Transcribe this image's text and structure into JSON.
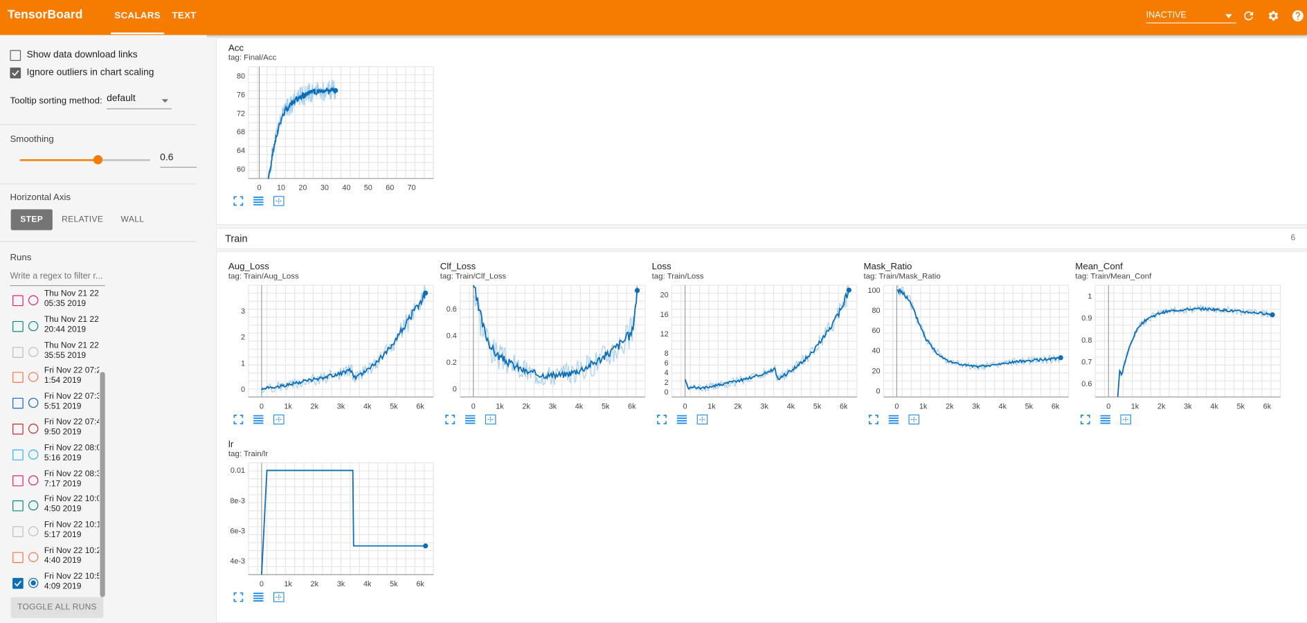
{
  "colors": {
    "accent": "#f57c00",
    "series": "#0d6eb5",
    "series_light": "#a7cff0"
  },
  "header": {
    "brand": "TensorBoard",
    "tabs": [
      "SCALARS",
      "TEXT"
    ],
    "status": "INACTIVE",
    "icons": [
      "refresh-icon",
      "settings-icon",
      "help-icon"
    ]
  },
  "sidebar": {
    "show_download": "Show data download links",
    "ignore_outliers": "Ignore outliers in chart scaling",
    "show_download_checked": false,
    "ignore_outliers_checked": true,
    "tooltip_label": "Tooltip sorting method:",
    "tooltip_value": "default",
    "smoothing_label": "Smoothing",
    "smoothing_value": "0.6",
    "smoothing_fraction": 0.6,
    "haxis_label": "Horizontal Axis",
    "haxis_options": [
      "STEP",
      "RELATIVE",
      "WALL"
    ],
    "haxis_selected": "STEP",
    "runs_label": "Runs",
    "filter_placeholder": "Write a regex to filter r...",
    "toggle_label": "TOGGLE ALL RUNS",
    "runs": [
      {
        "line1": "Thu Nov 21 22:",
        "line2": "05:35 2019",
        "color": "#e91e63",
        "checked": false
      },
      {
        "line1": "Thu Nov 21 22:",
        "line2": "20:44 2019",
        "color": "#00897b",
        "checked": false
      },
      {
        "line1": "Thu Nov 21 22:",
        "line2": "35:55 2019",
        "color": "#bdbdbd",
        "checked": false
      },
      {
        "line1": "Fri Nov 22 07:2",
        "line2": "1:54 2019",
        "color": "#ff7043",
        "checked": false
      },
      {
        "line1": "Fri Nov 22 07:3",
        "line2": "5:51 2019",
        "color": "#1565c0",
        "checked": false
      },
      {
        "line1": "Fri Nov 22 07:4",
        "line2": "9:50 2019",
        "color": "#c62828",
        "checked": false
      },
      {
        "line1": "Fri Nov 22 08:0",
        "line2": "5:16 2019",
        "color": "#29b6f6",
        "checked": false
      },
      {
        "line1": "Fri Nov 22 08:3",
        "line2": "7:17 2019",
        "color": "#e91e63",
        "checked": false
      },
      {
        "line1": "Fri Nov 22 10:0",
        "line2": "4:50 2019",
        "color": "#00897b",
        "checked": false
      },
      {
        "line1": "Fri Nov 22 10:1",
        "line2": "5:17 2019",
        "color": "#bdbdbd",
        "checked": false
      },
      {
        "line1": "Fri Nov 22 10:2",
        "line2": "4:40 2019",
        "color": "#ff7043",
        "checked": false
      },
      {
        "line1": "Fri Nov 22 10:5",
        "line2": "4:09 2019",
        "color": "#0d6eb5",
        "checked": true
      }
    ]
  },
  "main": {
    "train_section": {
      "name": "Train",
      "count": "6"
    },
    "chart_icons": [
      "expand-icon",
      "data-table-icon",
      "fit-domain-icon"
    ]
  },
  "chart_data": [
    {
      "id": "acc",
      "type": "line",
      "title": "Acc",
      "tag": "tag: Final/Acc",
      "xlim": [
        -5,
        80
      ],
      "ylim": [
        58,
        82
      ],
      "xticks": [
        "0",
        "10",
        "20",
        "30",
        "40",
        "50",
        "60",
        "70"
      ],
      "xtick_vals": [
        0,
        10,
        20,
        30,
        40,
        50,
        60,
        70
      ],
      "yticks": [
        "60",
        "64",
        "68",
        "72",
        "76",
        "80"
      ],
      "ytick_vals": [
        60,
        64,
        68,
        72,
        76,
        80
      ],
      "x": [
        4,
        6,
        8,
        10,
        12,
        14,
        16,
        18,
        20,
        23,
        26,
        30,
        35
      ],
      "y": [
        57,
        63,
        67.5,
        70.5,
        72.6,
        73.8,
        74.7,
        75.3,
        75.8,
        76.3,
        76.6,
        76.8,
        76.9
      ],
      "noise": 0.5,
      "seed": 1
    },
    {
      "id": "aug",
      "type": "line",
      "title": "Aug_Loss",
      "tag": "tag: Train/Aug_Loss",
      "xlim": [
        -500,
        6500
      ],
      "ylim": [
        -0.3,
        4
      ],
      "xticks": [
        "0",
        "1k",
        "2k",
        "3k",
        "4k",
        "5k",
        "6k"
      ],
      "xtick_vals": [
        0,
        1000,
        2000,
        3000,
        4000,
        5000,
        6000
      ],
      "yticks": [
        "0",
        "1",
        "2",
        "3"
      ],
      "ytick_vals": [
        0,
        1,
        2,
        3
      ],
      "x": [
        0,
        300,
        600,
        1000,
        1500,
        2000,
        2500,
        3000,
        3400,
        3500,
        3800,
        4200,
        4600,
        5000,
        5400,
        5700,
        6000,
        6200
      ],
      "y": [
        0,
        0.05,
        0.1,
        0.18,
        0.28,
        0.38,
        0.48,
        0.6,
        0.75,
        0.42,
        0.6,
        0.9,
        1.3,
        1.8,
        2.4,
        2.9,
        3.3,
        3.7
      ],
      "noise": 0.12,
      "seed": 2
    },
    {
      "id": "clf",
      "type": "line",
      "title": "Clf_Loss",
      "tag": "tag: Train/Clf_Loss",
      "xlim": [
        -500,
        6500
      ],
      "ylim": [
        -0.06,
        0.78
      ],
      "xticks": [
        "0",
        "1k",
        "2k",
        "3k",
        "4k",
        "5k",
        "6k"
      ],
      "xtick_vals": [
        0,
        1000,
        2000,
        3000,
        4000,
        5000,
        6000
      ],
      "yticks": [
        "0",
        "0.2",
        "0.4",
        "0.6"
      ],
      "ytick_vals": [
        0,
        0.2,
        0.4,
        0.6
      ],
      "x": [
        0,
        200,
        400,
        700,
        1000,
        1500,
        2000,
        2500,
        3000,
        3500,
        4000,
        4500,
        5000,
        5500,
        6000,
        6200
      ],
      "y": [
        0.78,
        0.6,
        0.45,
        0.3,
        0.24,
        0.18,
        0.13,
        0.11,
        0.1,
        0.11,
        0.14,
        0.19,
        0.25,
        0.33,
        0.42,
        0.74
      ],
      "noise": 0.04,
      "seed": 3
    },
    {
      "id": "loss",
      "type": "line",
      "title": "Loss",
      "tag": "tag: Train/Loss",
      "xlim": [
        -500,
        6500
      ],
      "ylim": [
        -1,
        22
      ],
      "xticks": [
        "0",
        "1k",
        "2k",
        "3k",
        "4k",
        "5k",
        "6k"
      ],
      "xtick_vals": [
        0,
        1000,
        2000,
        3000,
        4000,
        5000,
        6000
      ],
      "yticks": [
        "0",
        "2",
        "4",
        "6",
        "8",
        "12",
        "16",
        "20"
      ],
      "ytick_vals": [
        0,
        2,
        4,
        6,
        8,
        12,
        16,
        20
      ],
      "x": [
        0,
        150,
        300,
        500,
        1000,
        1500,
        2000,
        2500,
        3000,
        3400,
        3500,
        3800,
        4200,
        4600,
        5000,
        5400,
        5800,
        6200
      ],
      "y": [
        2.5,
        0.6,
        1.2,
        0.8,
        1.2,
        1.7,
        2.3,
        3,
        3.8,
        4.8,
        2.6,
        3.6,
        5.2,
        7,
        9.5,
        12.5,
        16,
        21
      ],
      "noise": 0.5,
      "seed": 4
    },
    {
      "id": "mask",
      "type": "line",
      "title": "Mask_Ratio",
      "tag": "tag: Train/Mask_Ratio",
      "xlim": [
        -500,
        6500
      ],
      "ylim": [
        -6,
        105
      ],
      "xticks": [
        "0",
        "1k",
        "2k",
        "3k",
        "4k",
        "5k",
        "6k"
      ],
      "xtick_vals": [
        0,
        1000,
        2000,
        3000,
        4000,
        5000,
        6000
      ],
      "yticks": [
        "0",
        "20",
        "40",
        "60",
        "80",
        "100"
      ],
      "ytick_vals": [
        0,
        20,
        40,
        60,
        80,
        100
      ],
      "x": [
        0,
        200,
        500,
        800,
        1100,
        1500,
        2000,
        2500,
        3000,
        3500,
        4000,
        4500,
        5000,
        5500,
        6000,
        6200
      ],
      "y": [
        100,
        99,
        88,
        70,
        52,
        38,
        29,
        26,
        24,
        25,
        27,
        29,
        30,
        31,
        32,
        33
      ],
      "noise": 1.6,
      "seed": 5
    },
    {
      "id": "conf",
      "type": "line",
      "title": "Mean_Conf",
      "tag": "tag: Train/Mean_Conf",
      "xlim": [
        -500,
        6500
      ],
      "ylim": [
        0.54,
        1.05
      ],
      "xticks": [
        "0",
        "1k",
        "2k",
        "3k",
        "4k",
        "5k",
        "6k"
      ],
      "xtick_vals": [
        0,
        1000,
        2000,
        3000,
        4000,
        5000,
        6000
      ],
      "yticks": [
        "0.6",
        "0.7",
        "0.8",
        "0.9",
        "1"
      ],
      "ytick_vals": [
        0.6,
        0.7,
        0.8,
        0.9,
        1
      ],
      "x": [
        350,
        420,
        500,
        600,
        800,
        1000,
        1200,
        1500,
        2000,
        2500,
        3000,
        3500,
        4000,
        5000,
        6000,
        6200
      ],
      "y": [
        0.54,
        0.66,
        0.64,
        0.69,
        0.77,
        0.83,
        0.87,
        0.9,
        0.925,
        0.935,
        0.94,
        0.942,
        0.94,
        0.93,
        0.92,
        0.915
      ],
      "noise": 0.004,
      "seed": 6
    },
    {
      "id": "lr",
      "type": "line",
      "title": "lr",
      "tag": "tag: Train/lr",
      "xlim": [
        -500,
        6500
      ],
      "ylim": [
        0.0031,
        0.0105
      ],
      "xticks": [
        "0",
        "1k",
        "2k",
        "3k",
        "4k",
        "5k",
        "6k"
      ],
      "xtick_vals": [
        0,
        1000,
        2000,
        3000,
        4000,
        5000,
        6000
      ],
      "yticks": [
        "4e-3",
        "6e-3",
        "8e-3",
        "0.01"
      ],
      "ytick_vals": [
        0.004,
        0.006,
        0.008,
        0.01
      ],
      "x": [
        0,
        200,
        3450,
        3480,
        6200
      ],
      "y": [
        0.0031,
        0.01,
        0.01,
        0.005,
        0.005
      ],
      "noise": 0,
      "seed": 7
    }
  ]
}
